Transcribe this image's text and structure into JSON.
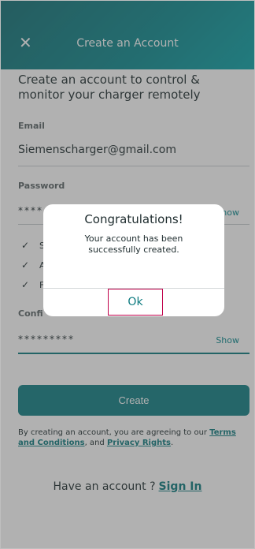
{
  "header": {
    "close_glyph": "✕",
    "title": "Create an Account"
  },
  "intro": "Create an account to control & monitor your charger remotely",
  "email": {
    "label": "Email",
    "value": "Siemenscharger@gmail.com"
  },
  "password": {
    "label": "Password",
    "value": "****",
    "show_label": "Show",
    "show_partial": "how"
  },
  "rules": [
    {
      "check": "✓",
      "text": "S"
    },
    {
      "check": "✓",
      "text": "A"
    },
    {
      "check": "✓",
      "text": "F"
    }
  ],
  "confirm": {
    "label": "Confirm Password",
    "label_partial": "Confi",
    "value": "*********",
    "show_label": "Show"
  },
  "create_button": "Create",
  "terms": {
    "prefix": "By creating an account, you are agreeing to our ",
    "terms_link": "Terms and Conditions",
    "middle": ", and ",
    "privacy_link": "Privacy Rights",
    "suffix": "."
  },
  "signin": {
    "prompt": "Have an account ?",
    "link": "Sign In"
  },
  "dialog": {
    "title": "Congratulations!",
    "message": "Your account has been successfully created.",
    "ok": "Ok"
  },
  "colors": {
    "brand": "#0e7e83",
    "header_start": "#0f6e73",
    "header_end": "#0aa3a8",
    "ok_border": "#c0004a"
  }
}
